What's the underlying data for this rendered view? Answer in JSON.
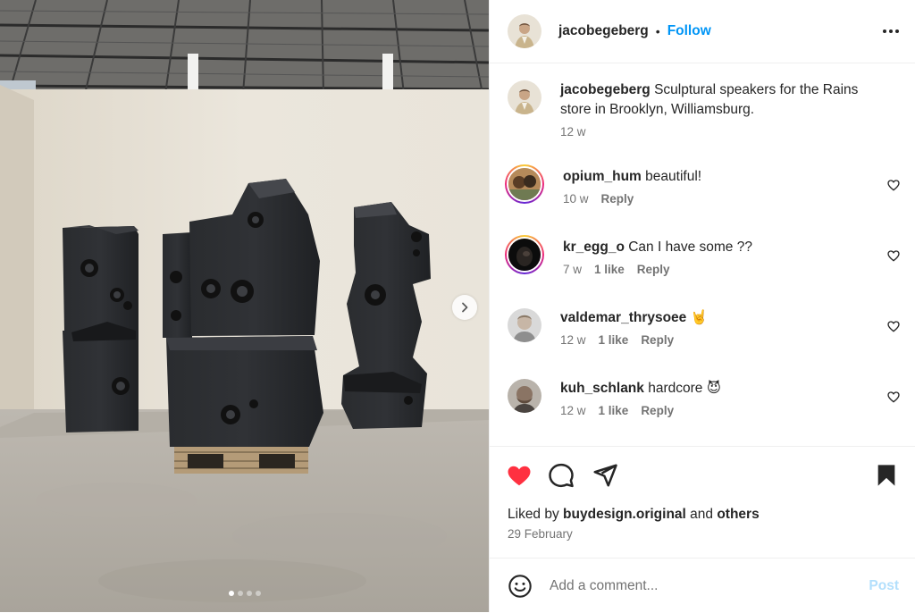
{
  "post": {
    "author": "jacobegeberg",
    "follow_label": "Follow",
    "separator": "•",
    "more_icon": "more-horizontal-icon"
  },
  "media": {
    "carousel_index": 1,
    "carousel_count": 4,
    "next_icon": "chevron-right-icon"
  },
  "caption": {
    "user": "jacobegeberg",
    "text": "Sculptural speakers for the Rains store in Brooklyn, Williamsburg.",
    "time": "12 w"
  },
  "comments": [
    {
      "user": "opium_hum",
      "text": "beautiful!",
      "time": "10 w",
      "likes": "",
      "reply": "Reply",
      "story_ring": true
    },
    {
      "user": "kr_egg_o",
      "text": "Can I have some ??",
      "time": "7 w",
      "likes": "1 like",
      "reply": "Reply",
      "story_ring": true
    },
    {
      "user": "valdemar_thrysoee",
      "text": "🤘",
      "time": "12 w",
      "likes": "1 like",
      "reply": "Reply",
      "story_ring": false
    },
    {
      "user": "kuh_schlank",
      "text": "hardcore 😈",
      "time": "12 w",
      "likes": "1 like",
      "reply": "Reply",
      "story_ring": false
    }
  ],
  "actions": {
    "like_icon": "heart-filled-icon",
    "comment_icon": "comment-icon",
    "share_icon": "send-icon",
    "save_icon": "bookmark-filled-icon",
    "like_color": "#ff3040"
  },
  "likes": {
    "prefix": "Liked by ",
    "user": "buydesign.original",
    "middle": " and ",
    "others": "others"
  },
  "date": "29 February",
  "add_comment": {
    "placeholder": "Add a comment...",
    "post_label": "Post",
    "emoji_icon": "emoji-smile-icon"
  },
  "colors": {
    "accent": "#0095f6",
    "muted": "#737373",
    "text": "#262626",
    "post_disabled": "#b2dffc"
  }
}
